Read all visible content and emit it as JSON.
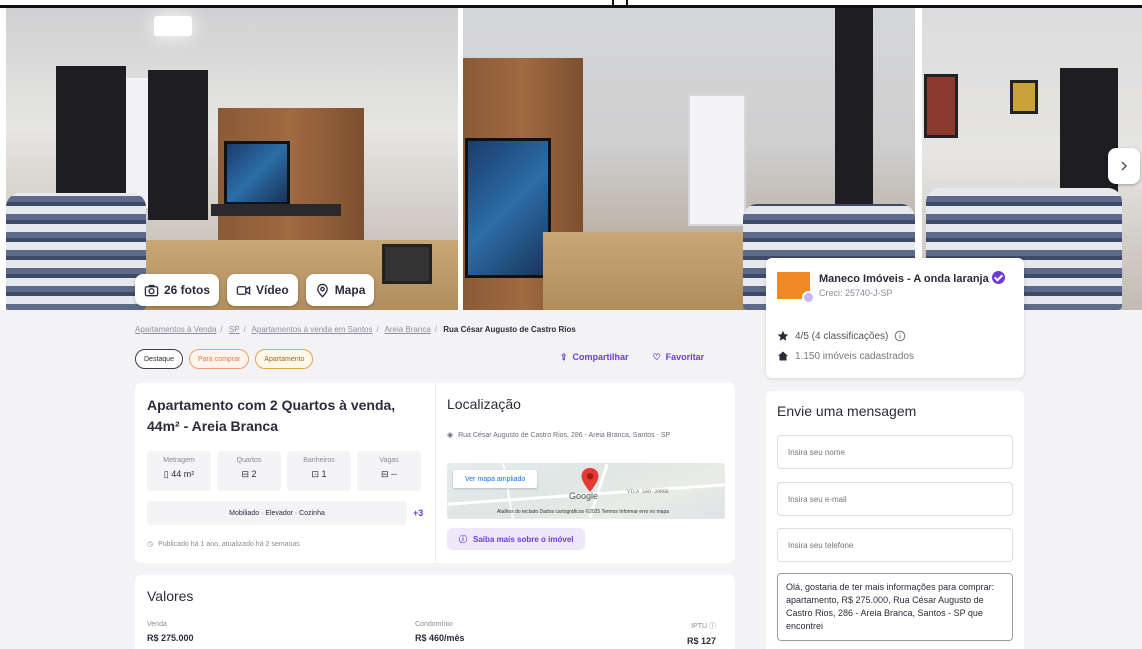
{
  "gallery": {
    "photos_label": "26 fotos",
    "video_label": "Vídeo",
    "map_label": "Mapa"
  },
  "advertiser": {
    "name": "Maneco Imóveis - A onda laranja",
    "creci": "Creci: 25740-J-SP",
    "rating": "4/5 (4 classificações)",
    "properties": "1.150 imóveis cadastrados",
    "logo_color": "#f08a24"
  },
  "breadcrumb": {
    "items": [
      "Apartamentos à Venda",
      "SP",
      "Apartamentos à venda em Santos",
      "Areia Branca"
    ],
    "current": "Rua César Augusto de Castro Rios"
  },
  "tags": [
    "Destaque",
    "Para comprar",
    "Apartamento"
  ],
  "actions": {
    "share": "Compartilhar",
    "favorite": "Favoritar"
  },
  "listing": {
    "title": "Apartamento com 2 Quartos à venda, 44m² - Areia Branca",
    "features": [
      {
        "label": "Metragem",
        "value": "44 m²",
        "icon": "ruler-icon",
        "glyph": "▯"
      },
      {
        "label": "Quartos",
        "value": "2",
        "icon": "bed-icon",
        "glyph": "⊟"
      },
      {
        "label": "Banheiros",
        "value": "1",
        "icon": "bath-icon",
        "glyph": "⊡"
      },
      {
        "label": "Vagas",
        "value": "--",
        "icon": "car-icon",
        "glyph": "⊟"
      }
    ],
    "amenities": "Mobiliado · Elevador · Cozinha",
    "amenities_more": "+3",
    "posted": "Publicado há 1 ano, atualizado há 2 semanas"
  },
  "location": {
    "title": "Localização",
    "address": "Rua César Augusto de Castro Rios, 286 - Areia Branca, Santos - SP",
    "map_button": "Ver mapa ampliado",
    "map_area": "VILA SÃO JORGE",
    "map_attribution": "Atalhos do teclado   Dados cartográficos ©2025   Termos   Informar erro no mapa",
    "know_more": "Saiba mais sobre o imóvel"
  },
  "values": {
    "title": "Valores",
    "items": [
      {
        "label": "Venda",
        "value": "R$ 275.000"
      },
      {
        "label": "Condomínio",
        "value": "R$ 460/mês"
      },
      {
        "label": "IPTU",
        "value": "R$ 127"
      }
    ]
  },
  "message": {
    "title": "Envie uma mensagem",
    "name_placeholder": "Insira seu nome",
    "email_placeholder": "Insira seu e-mail",
    "phone_placeholder": "Insira seu telefone",
    "text": "Olá, gostaria de ter mais informações para comprar: apartamento, R$ 275.000, Rua César Augusto de Castro Rios, 286 - Areia Branca, Santos - SP que encontrei"
  },
  "colors": {
    "accent": "#6d3cd4",
    "map_pin": "#e53935"
  }
}
